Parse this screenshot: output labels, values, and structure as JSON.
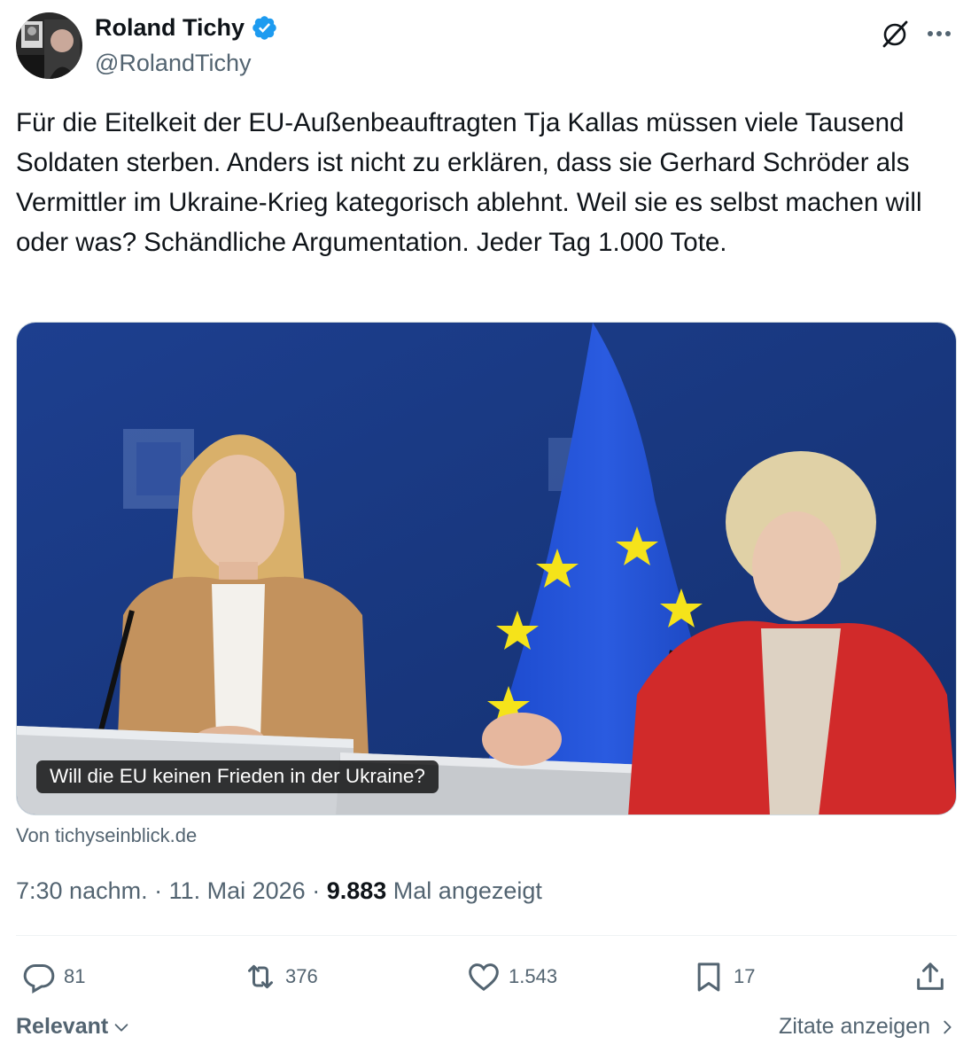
{
  "author": {
    "display_name": "Roland Tichy",
    "handle": "@RolandTichy",
    "verified": true
  },
  "icons": {
    "avatar": "avatar",
    "verified": "verified-badge-icon",
    "grok": "grok-icon",
    "more": "more-icon"
  },
  "tweet": {
    "text": "Für die Eitelkeit der EU-Außenbeauftragten Tja Kallas müssen viele Tausend Soldaten sterben. Anders ist nicht zu erklären, dass sie Gerhard Schröder als Vermittler im Ukraine-Krieg kategorisch ablehnt. Weil sie es selbst machen will oder was? Schändliche Argumentation. Jeder Tag 1.000 Tote."
  },
  "card": {
    "caption": "Will die EU keinen Frieden in der Ukraine?",
    "source": "Von tichyseinblick.de"
  },
  "meta": {
    "time": "7:30 nachm.",
    "separator": " · ",
    "date": "11. Mai 2026",
    "views_count": "9.883",
    "views_label": "Mal angezeigt"
  },
  "actions": {
    "replies": "81",
    "reposts": "376",
    "likes": "1.543",
    "bookmarks": "17"
  },
  "footer": {
    "sort_label": "Relevant",
    "quotes_label": "Zitate anzeigen"
  },
  "colors": {
    "text": "#0f1419",
    "secondary": "#536471",
    "verified_blue": "#1d9bf0",
    "eu_blue": "#1e3f9a",
    "eu_yellow": "#f5e31a"
  }
}
